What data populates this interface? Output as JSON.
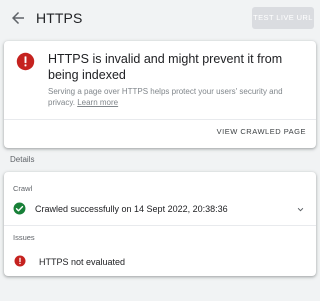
{
  "header": {
    "title": "HTTPS",
    "test_live_url_label": "TEST LIVE URL"
  },
  "alert": {
    "title": "HTTPS is invalid and might prevent it from being indexed",
    "description": "Serving a page over HTTPS helps protect your users' security and privacy.",
    "learn_more": "Learn more",
    "view_crawled_page_label": "VIEW CRAWLED PAGE"
  },
  "details": {
    "section_label": "Details",
    "crawl": {
      "heading": "Crawl",
      "status_text": "Crawled successfully on 14 Sept 2022, 20:38:36"
    },
    "issues": {
      "heading": "Issues",
      "items": [
        {
          "text": "HTTPS not evaluated"
        }
      ]
    }
  },
  "colors": {
    "error_red": "#c5221f",
    "success_green": "#188038",
    "disabled_button": "#dadce0"
  }
}
